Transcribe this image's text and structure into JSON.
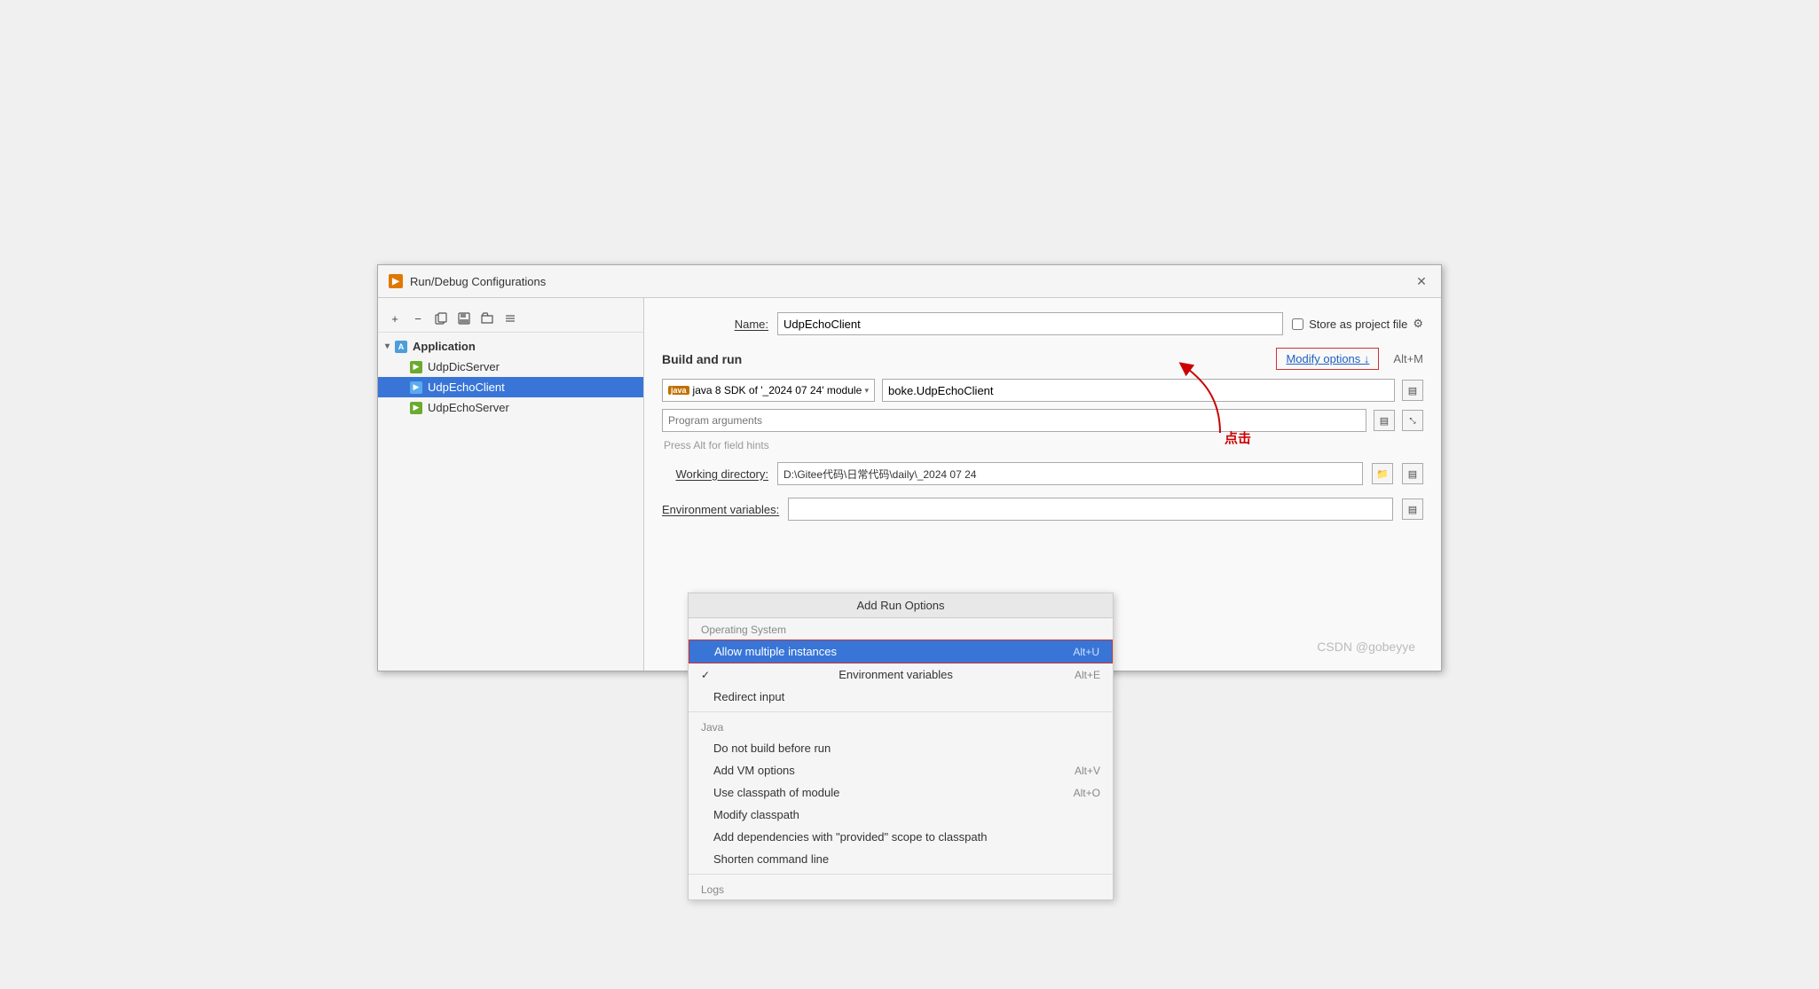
{
  "dialog": {
    "title": "Run/Debug Configurations",
    "close_label": "✕"
  },
  "toolbar": {
    "add_btn": "+",
    "remove_btn": "−",
    "copy_btn": "⧉",
    "save_btn": "💾",
    "folder_btn": "📁",
    "sort_btn": "↕"
  },
  "tree": {
    "group_label": "Application",
    "items": [
      {
        "label": "UdpDicServer",
        "selected": false
      },
      {
        "label": "UdpEchoClient",
        "selected": true
      },
      {
        "label": "UdpEchoServer",
        "selected": false
      }
    ]
  },
  "form": {
    "name_label": "Name:",
    "name_value": "UdpEchoClient",
    "store_label": "Store as project file",
    "section_title": "Build and run",
    "modify_btn_label": "Modify options ↓",
    "modify_shortcut": "Alt+M",
    "sdk_label": "java 8 SDK of '_2024 07 24' module",
    "main_class_value": "boke.UdpEchoClient",
    "program_args_placeholder": "Program arguments",
    "hint_text": "Press Alt for field hints",
    "working_dir_label": "Working directory:",
    "working_dir_value": "D:\\Gitee代码\\日常代码\\daily\\_2024 07 24",
    "env_vars_label": "Environment variables:"
  },
  "dropdown": {
    "header": "Add Run Options",
    "os_section": "Operating System",
    "items_os": [
      {
        "label": "Allow multiple instances",
        "shortcut": "Alt+U",
        "selected": true,
        "checked": false
      },
      {
        "label": "Environment variables",
        "shortcut": "Alt+E",
        "selected": false,
        "checked": true
      },
      {
        "label": "Redirect input",
        "shortcut": "",
        "selected": false,
        "checked": false
      }
    ],
    "java_section": "Java",
    "items_java": [
      {
        "label": "Do not build before run",
        "shortcut": "",
        "selected": false
      },
      {
        "label": "Add VM options",
        "shortcut": "Alt+V",
        "selected": false
      },
      {
        "label": "Use classpath of module",
        "shortcut": "Alt+O",
        "selected": false
      },
      {
        "label": "Modify classpath",
        "shortcut": "",
        "selected": false
      },
      {
        "label": "Add dependencies with \"provided\" scope to classpath",
        "shortcut": "",
        "selected": false
      },
      {
        "label": "Shorten command line",
        "shortcut": "",
        "selected": false
      }
    ],
    "logs_section": "Logs"
  },
  "annotations": {
    "click_text_1": "点击",
    "click_text_2": "点击"
  },
  "watermark": "CSDN @gobeyye"
}
